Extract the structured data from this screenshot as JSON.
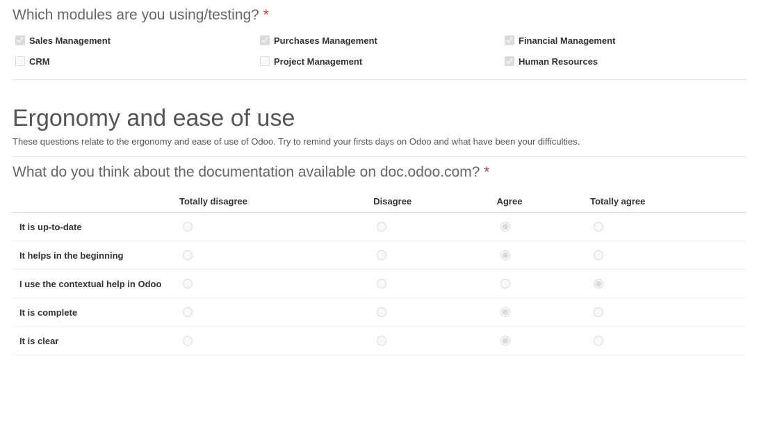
{
  "q1": {
    "title": "Which modules are you using/testing?",
    "required": true,
    "options": [
      {
        "label": "Sales Management",
        "checked": true
      },
      {
        "label": "Purchases Management",
        "checked": true
      },
      {
        "label": "Financial Management",
        "checked": true
      },
      {
        "label": "CRM",
        "checked": false
      },
      {
        "label": "Project Management",
        "checked": false
      },
      {
        "label": "Human Resources",
        "checked": true
      }
    ]
  },
  "section": {
    "title": "Ergonomy and ease of use",
    "description": "These questions relate to the ergonomy and ease of use of Odoo. Try to remind your firsts days on Odoo and what have been your difficulties."
  },
  "q2": {
    "title": "What do you think about the documentation available on doc.odoo.com?",
    "required": true,
    "columns": [
      "Totally disagree",
      "Disagree",
      "Agree",
      "Totally agree"
    ],
    "rows": [
      {
        "label": "It is up-to-date",
        "selected": 2
      },
      {
        "label": "It helps in the beginning",
        "selected": 2
      },
      {
        "label": "I use the contextual help in Odoo",
        "selected": 3
      },
      {
        "label": "It is complete",
        "selected": 2
      },
      {
        "label": "It is clear",
        "selected": 2
      }
    ]
  },
  "asterisk": "*"
}
